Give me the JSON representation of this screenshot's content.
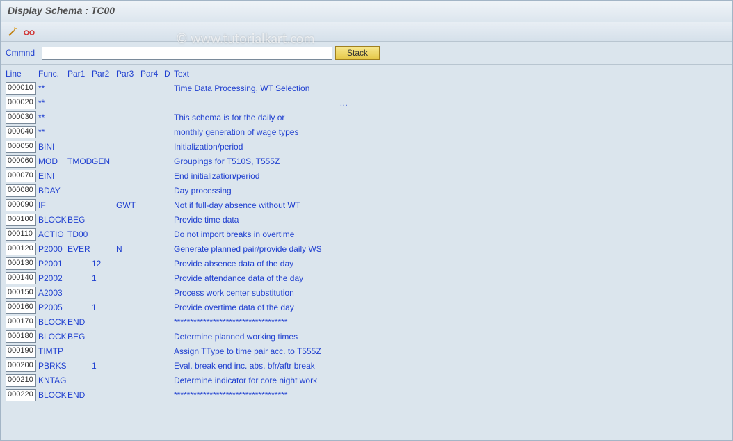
{
  "title": "Display Schema : TC00",
  "watermark": "© www.tutorialkart.com",
  "cmd": {
    "label": "Cmmnd",
    "stack_label": "Stack",
    "value": ""
  },
  "header": {
    "line": "Line",
    "func": "Func.",
    "p1": "Par1",
    "p2": "Par2",
    "p3": "Par3",
    "p4": "Par4",
    "d": "D",
    "text": "Text"
  },
  "rows": [
    {
      "line": "000010",
      "func": "**",
      "p1": "",
      "p2": "",
      "p3": "",
      "p4": "",
      "d": "",
      "text": "Time Data Processing, WT Selection"
    },
    {
      "line": "000020",
      "func": "**",
      "p1": "",
      "p2": "",
      "p3": "",
      "p4": "",
      "d": "",
      "text": "==================================…"
    },
    {
      "line": "000030",
      "func": "**",
      "p1": "",
      "p2": "",
      "p3": "",
      "p4": "",
      "d": "",
      "text": "This schema is for the daily or"
    },
    {
      "line": "000040",
      "func": "**",
      "p1": "",
      "p2": "",
      "p3": "",
      "p4": "",
      "d": "",
      "text": "monthly generation of wage types"
    },
    {
      "line": "000050",
      "func": "BINI",
      "p1": "",
      "p2": "",
      "p3": "",
      "p4": "",
      "d": "",
      "text": "Initialization/period"
    },
    {
      "line": "000060",
      "func": "MOD",
      "p1": "TMOD",
      "p2": "GEN",
      "p3": "",
      "p4": "",
      "d": "",
      "text": "Groupings for T510S, T555Z"
    },
    {
      "line": "000070",
      "func": "EINI",
      "p1": "",
      "p2": "",
      "p3": "",
      "p4": "",
      "d": "",
      "text": "End initialization/period"
    },
    {
      "line": "000080",
      "func": "BDAY",
      "p1": "",
      "p2": "",
      "p3": "",
      "p4": "",
      "d": "",
      "text": "Day processing"
    },
    {
      "line": "000090",
      "func": "IF",
      "p1": "",
      "p2": "",
      "p3": "GWT",
      "p4": "",
      "d": "",
      "text": "Not if full-day absence without WT"
    },
    {
      "line": "000100",
      "func": "BLOCK",
      "p1": "BEG",
      "p2": "",
      "p3": "",
      "p4": "",
      "d": "",
      "text": "Provide time data"
    },
    {
      "line": "000110",
      "func": "ACTIO",
      "p1": "TD00",
      "p2": "",
      "p3": "",
      "p4": "",
      "d": "",
      "text": "Do not import breaks in overtime"
    },
    {
      "line": "000120",
      "func": "P2000",
      "p1": "EVER",
      "p2": "",
      "p3": "N",
      "p4": "",
      "d": "",
      "text": "Generate planned pair/provide daily WS"
    },
    {
      "line": "000130",
      "func": "P2001",
      "p1": "",
      "p2": "12",
      "p3": "",
      "p4": "",
      "d": "",
      "text": "Provide absence data of the day"
    },
    {
      "line": "000140",
      "func": "P2002",
      "p1": "",
      "p2": "1",
      "p3": "",
      "p4": "",
      "d": "",
      "text": "Provide attendance data of the day"
    },
    {
      "line": "000150",
      "func": "A2003",
      "p1": "",
      "p2": "",
      "p3": "",
      "p4": "",
      "d": "",
      "text": "Process work center substitution"
    },
    {
      "line": "000160",
      "func": "P2005",
      "p1": "",
      "p2": "1",
      "p3": "",
      "p4": "",
      "d": "",
      "text": "Provide overtime data of the day"
    },
    {
      "line": "000170",
      "func": "BLOCK",
      "p1": "END",
      "p2": "",
      "p3": "",
      "p4": "",
      "d": "",
      "text": "***********************************"
    },
    {
      "line": "000180",
      "func": "BLOCK",
      "p1": "BEG",
      "p2": "",
      "p3": "",
      "p4": "",
      "d": "",
      "text": "Determine planned working times"
    },
    {
      "line": "000190",
      "func": "TIMTP",
      "p1": "",
      "p2": "",
      "p3": "",
      "p4": "",
      "d": "",
      "text": "Assign TType to time pair acc. to T555Z"
    },
    {
      "line": "000200",
      "func": "PBRKS",
      "p1": "",
      "p2": "1",
      "p3": "",
      "p4": "",
      "d": "",
      "text": "Eval. break end inc. abs. bfr/aftr break"
    },
    {
      "line": "000210",
      "func": "KNTAG",
      "p1": "",
      "p2": "",
      "p3": "",
      "p4": "",
      "d": "",
      "text": "Determine indicator for core night work"
    },
    {
      "line": "000220",
      "func": "BLOCK",
      "p1": "END",
      "p2": "",
      "p3": "",
      "p4": "",
      "d": "",
      "text": "***********************************"
    }
  ]
}
